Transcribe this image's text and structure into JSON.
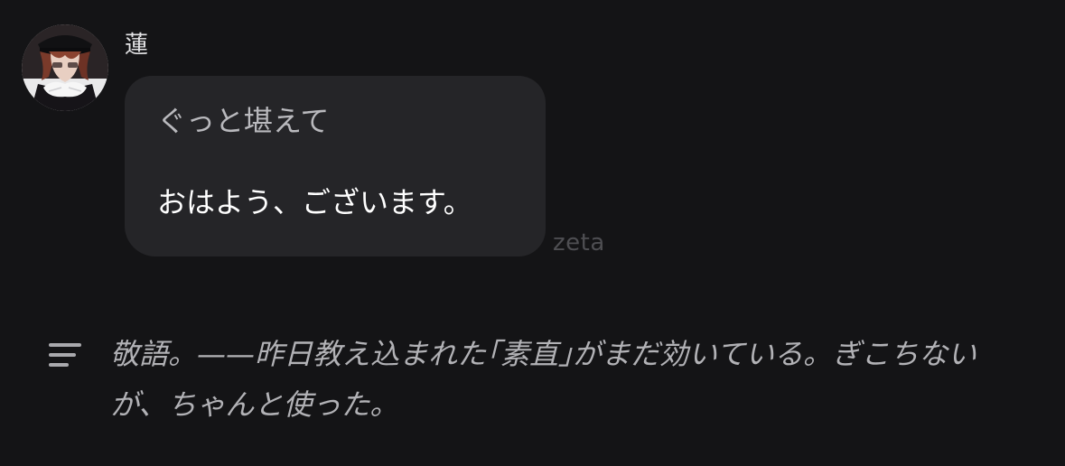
{
  "message": {
    "sender_name": "蓮",
    "avatar": "character-portrait",
    "bubble": {
      "action_text": "ぐっと堪えて",
      "speech_text": "おはよう、ございます。"
    },
    "watermark": "zeta"
  },
  "narration": {
    "icon": "text-lines-icon",
    "text": "敬語。——昨日教え込まれた｢素直｣がまだ効いている。ぎこちないが、ちゃんと使った。"
  },
  "colors": {
    "background": "#141416",
    "bubble": "#252528",
    "narration_text": "#b2b2b6"
  }
}
